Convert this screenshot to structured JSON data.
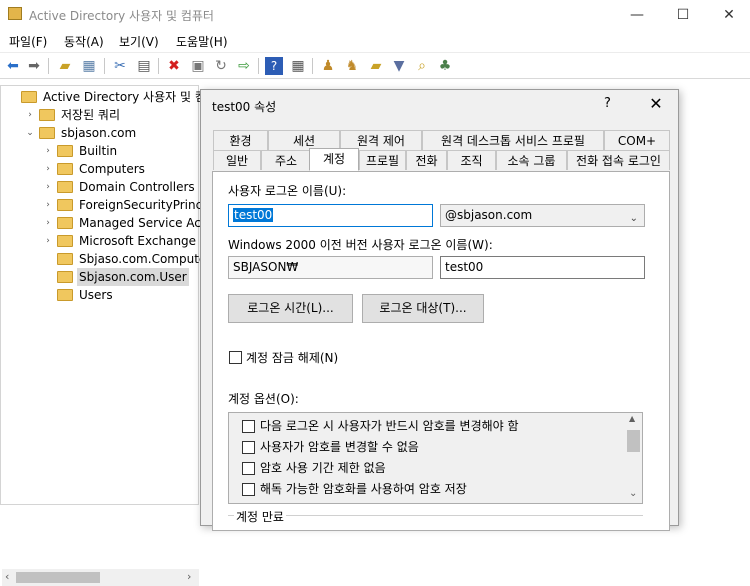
{
  "window": {
    "title": "Active Directory 사용자 및 컴퓨터",
    "minimize": "—",
    "maximize": "☐",
    "close": "✕"
  },
  "menu": [
    "파일(F)",
    "동작(A)",
    "보기(V)",
    "도움말(H)"
  ],
  "toolbar": {
    "icons": [
      "back-icon",
      "forward-icon",
      "up-folder-icon",
      "show-tree-icon",
      "cut-icon",
      "copy-icon",
      "delete-icon",
      "properties-icon",
      "refresh-icon",
      "export-list-icon",
      "help-icon",
      "console-icon",
      "new-user-icon",
      "new-group-icon",
      "new-ou-icon",
      "filter-icon",
      "find-icon",
      "add-to-group-icon"
    ]
  },
  "tree": {
    "items": [
      {
        "label": "Active Directory 사용자 및 컴퓨터",
        "indent": 0,
        "twisty": ""
      },
      {
        "label": "저장된 쿼리",
        "indent": 1,
        "twisty": "›"
      },
      {
        "label": "sbjason.com",
        "indent": 1,
        "twisty": "⌄"
      },
      {
        "label": "Builtin",
        "indent": 2,
        "twisty": "›"
      },
      {
        "label": "Computers",
        "indent": 2,
        "twisty": "›"
      },
      {
        "label": "Domain Controllers",
        "indent": 2,
        "twisty": "›"
      },
      {
        "label": "ForeignSecurityPrincipals",
        "indent": 2,
        "twisty": "›"
      },
      {
        "label": "Managed Service Accounts",
        "indent": 2,
        "twisty": "›"
      },
      {
        "label": "Microsoft Exchange Security",
        "indent": 2,
        "twisty": "›"
      },
      {
        "label": "Sbjaso.com.Computer",
        "indent": 2,
        "twisty": ""
      },
      {
        "label": "Sbjason.com.User",
        "indent": 2,
        "twisty": "",
        "selected": true
      },
      {
        "label": "Users",
        "indent": 2,
        "twisty": ""
      }
    ],
    "scroll_left": "‹",
    "scroll_right": "›"
  },
  "dialog": {
    "title": "test00 속성",
    "help": "?",
    "close": "✕",
    "tabs_row1": [
      "환경",
      "세션",
      "원격 제어",
      "원격 데스크톱 서비스 프로필",
      "COM+"
    ],
    "tabs_row2": [
      "일반",
      "주소",
      "계정",
      "프로필",
      "전화",
      "조직",
      "소속 그룹",
      "전화 접속 로그인"
    ],
    "active_tab": "계정",
    "logon_name_label": "사용자 로그온 이름(U):",
    "logon_name_value": "test00",
    "upn_suffix": "@sbjason.com",
    "pre2000_label": "Windows 2000 이전 버전 사용자 로그온 이름(W):",
    "pre2000_domain": "SBJASON₩",
    "pre2000_name": "test00",
    "logon_hours_button": "로그온 시간(L)...",
    "logon_to_button": "로그온 대상(T)...",
    "unlock_label": "계정 잠금 해제(N)",
    "options_label": "계정 옵션(O):",
    "options": [
      "다음 로그온 시 사용자가 반드시 암호를 변경해야 함",
      "사용자가 암호를 변경할 수 없음",
      "암호 사용 기간 제한 없음",
      "해독 가능한 암호화를 사용하여 암호 저장"
    ],
    "expiry_label": "계정 만료"
  },
  "colors": {
    "selection": "#0078d7",
    "folder": "#f0c75e",
    "dialog_bg": "#f0f0f0"
  }
}
